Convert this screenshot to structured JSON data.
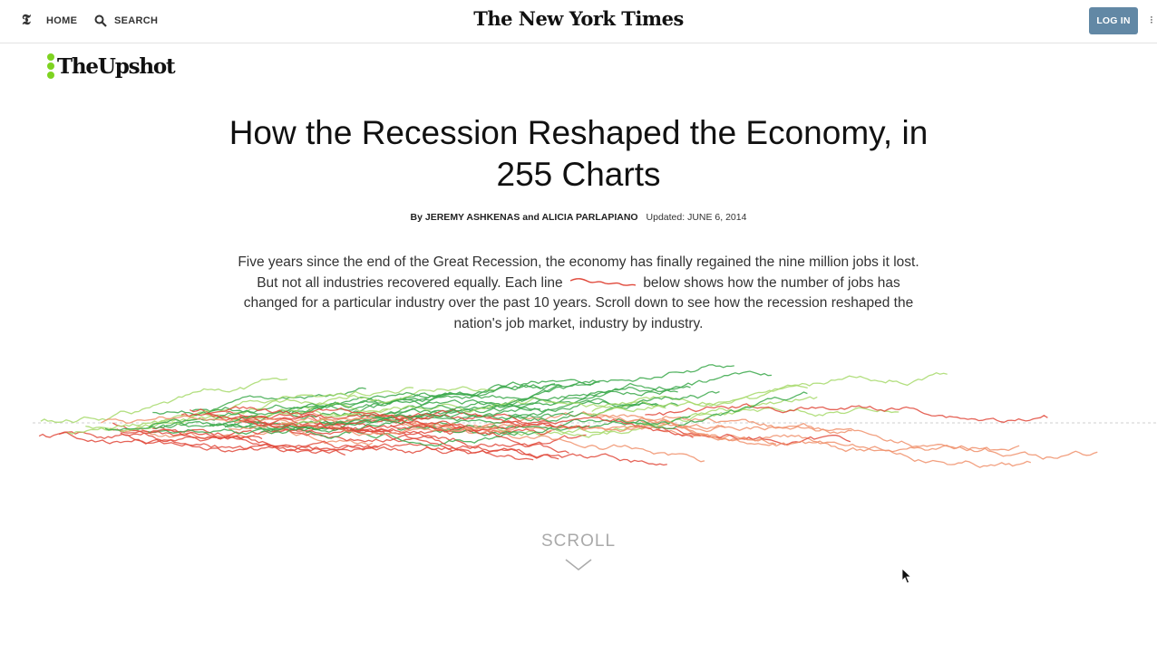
{
  "header": {
    "home_label": "HOME",
    "search_label": "SEARCH",
    "masthead": "The New York Times",
    "login_label": "LOG IN"
  },
  "section": {
    "name": "TheUpshot"
  },
  "article": {
    "headline": "How the Recession Reshaped the Economy, in 255 Charts",
    "byline_authors": "By JEREMY ASHKENAS and ALICIA PARLAPIANO",
    "byline_updated": "Updated: JUNE 6, 2014",
    "intro_part1": "Five years since the end of the Great Recession, the economy has finally regained the nine million jobs it lost. But not all industries recovered equally. Each line",
    "intro_part2": "below shows how the number of jobs has changed for a particular industry over the past 10 years. Scroll down to see how the recession reshaped the nation's job market, industry by industry."
  },
  "scroll": {
    "label": "SCROLL"
  },
  "colors": {
    "accent_green": "#7ed321",
    "login_bg": "#6288a5",
    "gain_green": "#3aa84a",
    "light_green": "#a6d96a",
    "loss_red": "#e0483a",
    "loss_salmon": "#f08f6a"
  },
  "chart_data": {
    "type": "line",
    "description_series": "industry job-change lines (gains in green, losses in red)",
    "series_count": 60
  }
}
